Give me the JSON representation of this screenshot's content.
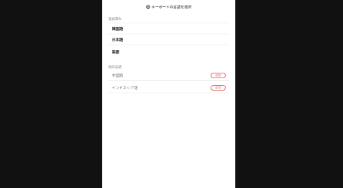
{
  "header": {
    "title": "キーボードの言語を選択",
    "icon": "globe-icon"
  },
  "added_section": {
    "label": "追加済み",
    "items": [
      {
        "name": "韓国語"
      },
      {
        "name": "日本語"
      },
      {
        "name": "英語"
      }
    ]
  },
  "other_section": {
    "label": "他の言語",
    "items": [
      {
        "name": "中国語",
        "action_label": "追加"
      },
      {
        "name": "インドネシア語",
        "action_label": "追加"
      }
    ]
  },
  "colors": {
    "backdrop": "#111111",
    "panel": "#ffffff",
    "accent": "#e06a6a"
  }
}
